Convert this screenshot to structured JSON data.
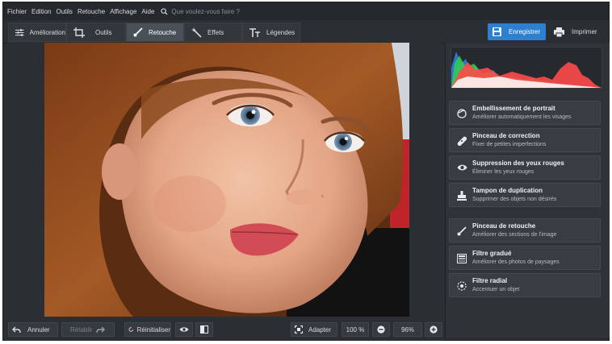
{
  "menu": [
    "Fichier",
    "Edition",
    "Outils",
    "Retouche",
    "Affichage",
    "Aide"
  ],
  "search_placeholder": "Que voulez-vous faire ?",
  "tabs": [
    {
      "label": "Amélioration",
      "icon": "sliders-icon"
    },
    {
      "label": "Outils",
      "icon": "crop-icon"
    },
    {
      "label": "Retouche",
      "icon": "brush-icon",
      "active": true
    },
    {
      "label": "Effets",
      "icon": "magic-wand-icon"
    },
    {
      "label": "Légendes",
      "icon": "text-icon"
    }
  ],
  "actions": {
    "save": "Enregistrer",
    "print": "Imprimer"
  },
  "tools": [
    {
      "title": "Embellissement de portrait",
      "subtitle": "Améliorer automatiquement les visages",
      "icon": "portrait-icon"
    },
    {
      "title": "Pinceau de correction",
      "subtitle": "Fixer de petites imperfections",
      "icon": "bandage-icon"
    },
    {
      "title": "Suppression des yeux rouges",
      "subtitle": "Éliminer les yeux rouges",
      "icon": "eye-icon"
    },
    {
      "title": "Tampon de duplication",
      "subtitle": "Supprimer des objets non désirés",
      "icon": "stamp-icon"
    },
    {
      "title": "Pinceau de retouche",
      "subtitle": "Améliorer des sections de l'image",
      "icon": "brush-icon"
    },
    {
      "title": "Filtre gradué",
      "subtitle": "Améliorer des photos de paysages",
      "icon": "gradient-icon"
    },
    {
      "title": "Filtre radial",
      "subtitle": "Accentuer un objet",
      "icon": "radial-icon"
    }
  ],
  "bottom": {
    "undo": "Annuler",
    "redo": "Rétablir",
    "reset": "Réinitialiser",
    "fit": "Adapter",
    "zoom_100": "100 %",
    "zoom_current": "96%"
  },
  "colors": {
    "accent": "#2d7fd0",
    "panel": "#393d43",
    "background": "#2b2e32"
  }
}
